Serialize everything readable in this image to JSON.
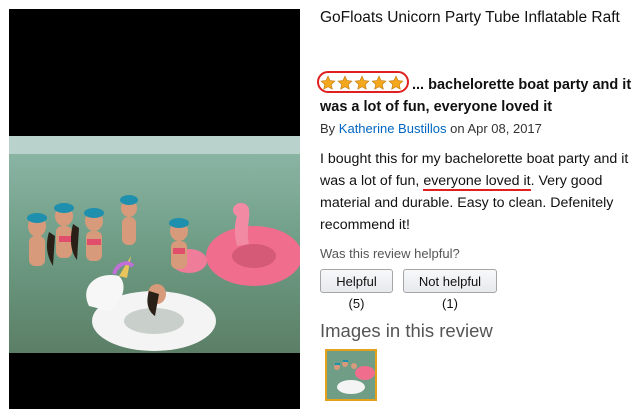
{
  "product": {
    "title": "GoFloats Unicorn Party Tube Inflatable Raft"
  },
  "review": {
    "rating": 5,
    "rating_max": 5,
    "headline": "... bachelorette boat party and it was a lot of fun, everyone loved it",
    "by_prefix": "By",
    "author": "Katherine Bustillos",
    "date_text": "on Apr 08, 2017",
    "body_before": "I bought this for my bachelorette boat party and it was a lot of fun, ",
    "body_highlight": "everyone loved it",
    "body_after": ". Very good material and durable. Easy to clean. Defenitely recommend it!"
  },
  "helpful": {
    "question": "Was this review helpful?",
    "helpful_label": "Helpful (5)",
    "not_helpful_label": "Not helpful (1)"
  },
  "images_section": {
    "heading": "Images in this review"
  },
  "colors": {
    "star_fill": "#f4a81d",
    "annotation_red": "#e02020",
    "link_blue": "#0066c0",
    "thumb_border": "#e4a11b"
  }
}
